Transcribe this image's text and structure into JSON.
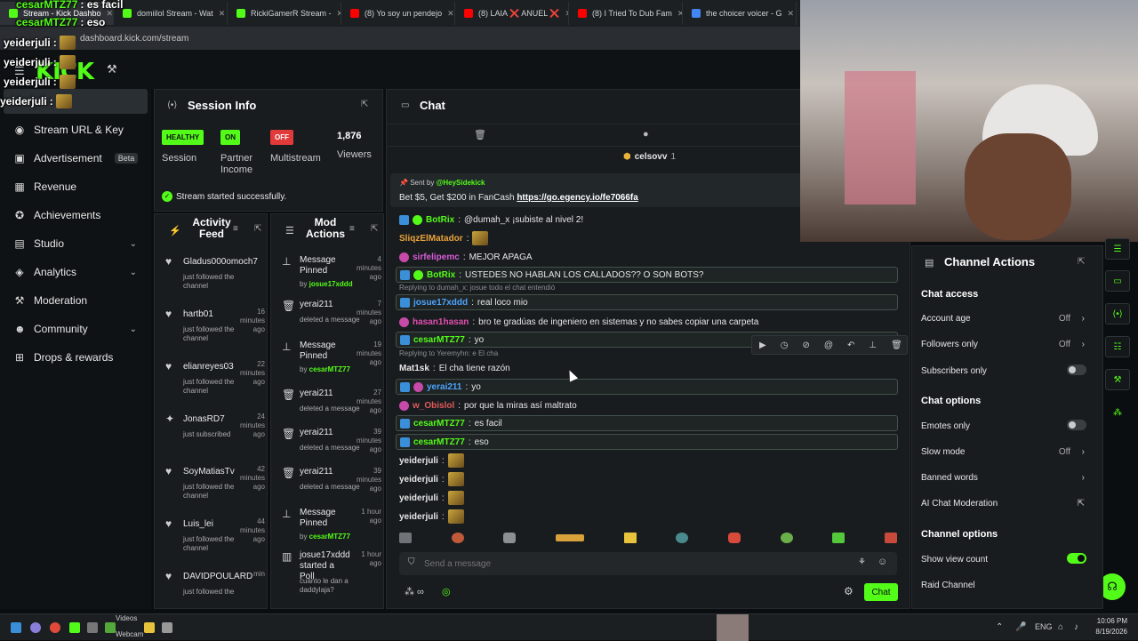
{
  "browser": {
    "tabs": [
      {
        "label": "Stream - Kick Dashbo",
        "color": "#53fc18"
      },
      {
        "label": "domiilol Stream - Wat",
        "color": "#53fc18"
      },
      {
        "label": "RickiGamerR Stream -",
        "color": "#53fc18"
      },
      {
        "label": "(8) Yo soy un pendejo",
        "color": "#ff0000"
      },
      {
        "label": "(8) LAIA ❌ ANUEL ❌",
        "color": "#ff0000"
      },
      {
        "label": "(8) I Tried To Dub Fam",
        "color": "#ff0000"
      },
      {
        "label": "the choicer voicer - G",
        "color": "#4285f4"
      }
    ],
    "url": "dashboard.kick.com/stream"
  },
  "overlay_chat": [
    {
      "user": "cesarMTZ77",
      "text": ": es facil"
    },
    {
      "user": "cesarMTZ77",
      "text": ": eso"
    },
    {
      "user": "yeiderjuli",
      "text": ":"
    },
    {
      "user": "yeiderjuli",
      "text": ":"
    },
    {
      "user": "yeiderjuli",
      "text": ":"
    },
    {
      "user": "yeiderjuli",
      "text": ":"
    }
  ],
  "logo": "KICK",
  "sidebar": {
    "items": [
      {
        "label": "Stream URL & Key",
        "icon": "key-icon"
      },
      {
        "label": "Advertisement",
        "icon": "ad-icon",
        "badge": "Beta"
      },
      {
        "label": "Revenue",
        "icon": "revenue-icon"
      },
      {
        "label": "Achievements",
        "icon": "trophy-icon"
      },
      {
        "label": "Studio",
        "icon": "studio-icon",
        "expand": true
      },
      {
        "label": "Analytics",
        "icon": "analytics-icon",
        "expand": true
      },
      {
        "label": "Moderation",
        "icon": "hammer-icon"
      },
      {
        "label": "Community",
        "icon": "community-icon",
        "expand": true
      },
      {
        "label": "Drops & rewards",
        "icon": "gift-icon"
      }
    ]
  },
  "session": {
    "title": "Session Info",
    "health": {
      "tag": "HEALTHY",
      "label": "Session"
    },
    "partner": {
      "tag": "ON",
      "label": "Partner Income"
    },
    "multistream": {
      "tag": "OFF",
      "label": "Multistream"
    },
    "viewers": {
      "value": "1,876",
      "label": "Viewers"
    },
    "status": "Stream started successfully."
  },
  "activity": {
    "title": "Activity Feed",
    "items": [
      {
        "name": "Gladus000omoch7",
        "time": "",
        "desc": "just followed the channel",
        "icon": "heart-icon"
      },
      {
        "name": "hartb01",
        "time": "16 minutes ago",
        "desc": "just followed the channel",
        "icon": "heart-icon"
      },
      {
        "name": "elianreyes03",
        "time": "22 minutes ago",
        "desc": "just followed the channel",
        "icon": "heart-icon"
      },
      {
        "name": "JonasRD7",
        "time": "24 minutes ago",
        "desc": "just subscribed",
        "icon": "star-icon"
      },
      {
        "name": "SoyMatiasTv",
        "time": "42 minutes ago",
        "desc": "just followed the channel",
        "icon": "heart-icon"
      },
      {
        "name": "Luis_lei",
        "time": "44 minutes ago",
        "desc": "just followed the channel",
        "icon": "heart-icon"
      },
      {
        "name": "DAVIDPOULARD",
        "time": "min",
        "desc": "just followed the",
        "icon": "heart-icon"
      }
    ]
  },
  "mod": {
    "title": "Mod Actions",
    "items": [
      {
        "title": "Message Pinned",
        "time": "4 minutes ago",
        "sub_pre": "by ",
        "sub_user": "josue17xddd",
        "icon": "pin-icon"
      },
      {
        "title": "yerai211",
        "time": "7 minutes ago",
        "sub_pre": "deleted a message",
        "sub_user": "",
        "icon": "trash-icon"
      },
      {
        "title": "Message Pinned",
        "time": "19 minutes ago",
        "sub_pre": "by ",
        "sub_user": "cesarMTZ77",
        "icon": "pin-icon"
      },
      {
        "title": "yerai211",
        "time": "27 minutes ago",
        "sub_pre": "deleted a message",
        "sub_user": "",
        "icon": "trash-icon"
      },
      {
        "title": "yerai211",
        "time": "39 minutes ago",
        "sub_pre": "deleted a message",
        "sub_user": "",
        "icon": "trash-icon"
      },
      {
        "title": "yerai211",
        "time": "39 minutes ago",
        "sub_pre": "deleted a message",
        "sub_user": "",
        "icon": "trash-icon"
      },
      {
        "title": "Message Pinned",
        "time": "1 hour ago",
        "sub_pre": "by ",
        "sub_user": "cesarMTZ77",
        "icon": "pin-icon"
      },
      {
        "title": "josue17xddd started a Poll",
        "time": "1 hour ago",
        "sub_pre": "cuanto le dan a daddylaja?",
        "sub_user": "",
        "icon": "poll-icon"
      }
    ]
  },
  "chat": {
    "title": "Chat",
    "top_user": "celsovv",
    "top_count": "1",
    "pinned": {
      "sent_by": "Sent by",
      "user": "@HeySidekick",
      "text": "Bet $5, Get $200 in FanCash",
      "link": "https://go.egency.io/fe7066fa"
    },
    "messages": [
      {
        "user": "BotRix",
        "color": "#53fc18",
        "text": "@dumah_x ¡subiste al nivel 2!",
        "hl": false
      },
      {
        "user": "SliqzElMatador",
        "color": "#e8a33a",
        "text": "",
        "hl": false,
        "emote": true
      },
      {
        "user": "sirfelipemc",
        "color": "#d65bd8",
        "text": "MEJOR APAGA",
        "hl": false
      },
      {
        "user": "BotRix",
        "color": "#53fc18",
        "text": "USTEDES NO HABLAN LOS CALLADOS?? O SON BOTS?",
        "hl": true
      },
      {
        "user": "josue17xddd",
        "color": "#4da3ff",
        "text": "real loco mio",
        "hl": true,
        "reply": "Replying to dumah_x: josue todo el chat entendió"
      },
      {
        "user": "hasan1hasan",
        "color": "#e04fae",
        "text": "bro te gradúas de ingeniero en sistemas y no sabes copiar una carpeta",
        "hl": false
      },
      {
        "user": "cesarMTZ77",
        "color": "#53fc18",
        "text": "yo",
        "hl": true
      },
      {
        "user": "Mat1sk",
        "color": "#e6e6e6",
        "text": "El cha tiene razón",
        "hl": false,
        "reply": "Replying to Yeremyhn: e El cha"
      },
      {
        "user": "yerai211",
        "color": "#4da3ff",
        "text": "yo",
        "hl": true
      },
      {
        "user": "w_Obislol",
        "color": "#e05a5a",
        "text": "por que la miras así maltrato",
        "hl": false
      },
      {
        "user": "cesarMTZ77",
        "color": "#53fc18",
        "text": "es facil",
        "hl": true
      },
      {
        "user": "cesarMTZ77",
        "color": "#53fc18",
        "text": "eso",
        "hl": true
      },
      {
        "user": "yeiderjuli",
        "color": "#e6e6e6",
        "text": "",
        "hl": false,
        "emote": true
      },
      {
        "user": "yeiderjuli",
        "color": "#e6e6e6",
        "text": "",
        "hl": false,
        "emote": true
      },
      {
        "user": "yeiderjuli",
        "color": "#e6e6e6",
        "text": "",
        "hl": false,
        "emote": true
      },
      {
        "user": "yeiderjuli",
        "color": "#e6e6e6",
        "text": "",
        "hl": false,
        "emote": true
      }
    ],
    "input_placeholder": "Send a message",
    "send_label": "Chat"
  },
  "channel_actions": {
    "title": "Channel Actions",
    "access_title": "Chat access",
    "account_age": {
      "label": "Account age",
      "value": "Off"
    },
    "followers_only": {
      "label": "Followers only",
      "value": "Off"
    },
    "subscribers_only": {
      "label": "Subscribers only",
      "on": false
    },
    "options_title": "Chat options",
    "emotes_only": {
      "label": "Emotes only",
      "on": false
    },
    "slow_mode": {
      "label": "Slow mode",
      "value": "Off"
    },
    "banned_words": {
      "label": "Banned words"
    },
    "ai_moderation": {
      "label": "AI Chat Moderation"
    },
    "channel_options_title": "Channel options",
    "show_view_count": {
      "label": "Show view count",
      "on": true
    },
    "raid": {
      "label": "Raid Channel"
    }
  },
  "taskbar": {
    "videos_label": "Videos",
    "webcam_label": "Webcam",
    "lang": "ENG",
    "time": "10:06 PM",
    "date": "8/19/2026"
  }
}
